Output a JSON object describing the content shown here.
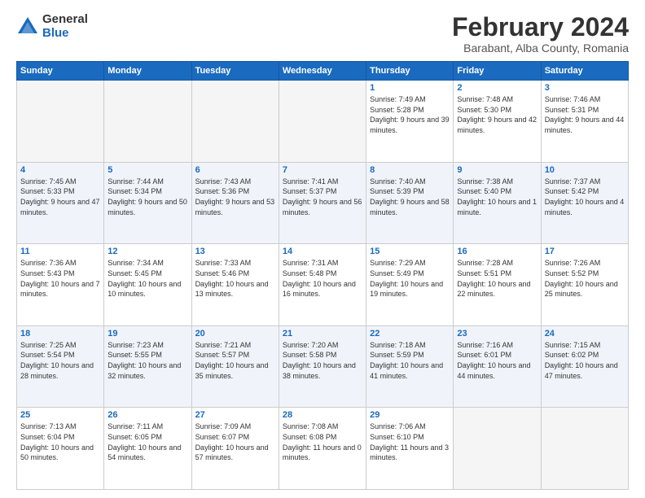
{
  "logo": {
    "general": "General",
    "blue": "Blue"
  },
  "title": "February 2024",
  "subtitle": "Barabant, Alba County, Romania",
  "weekdays": [
    "Sunday",
    "Monday",
    "Tuesday",
    "Wednesday",
    "Thursday",
    "Friday",
    "Saturday"
  ],
  "weeks": [
    [
      {
        "day": "",
        "info": ""
      },
      {
        "day": "",
        "info": ""
      },
      {
        "day": "",
        "info": ""
      },
      {
        "day": "",
        "info": ""
      },
      {
        "day": "1",
        "info": "Sunrise: 7:49 AM\nSunset: 5:28 PM\nDaylight: 9 hours\nand 39 minutes."
      },
      {
        "day": "2",
        "info": "Sunrise: 7:48 AM\nSunset: 5:30 PM\nDaylight: 9 hours\nand 42 minutes."
      },
      {
        "day": "3",
        "info": "Sunrise: 7:46 AM\nSunset: 5:31 PM\nDaylight: 9 hours\nand 44 minutes."
      }
    ],
    [
      {
        "day": "4",
        "info": "Sunrise: 7:45 AM\nSunset: 5:33 PM\nDaylight: 9 hours\nand 47 minutes."
      },
      {
        "day": "5",
        "info": "Sunrise: 7:44 AM\nSunset: 5:34 PM\nDaylight: 9 hours\nand 50 minutes."
      },
      {
        "day": "6",
        "info": "Sunrise: 7:43 AM\nSunset: 5:36 PM\nDaylight: 9 hours\nand 53 minutes."
      },
      {
        "day": "7",
        "info": "Sunrise: 7:41 AM\nSunset: 5:37 PM\nDaylight: 9 hours\nand 56 minutes."
      },
      {
        "day": "8",
        "info": "Sunrise: 7:40 AM\nSunset: 5:39 PM\nDaylight: 9 hours\nand 58 minutes."
      },
      {
        "day": "9",
        "info": "Sunrise: 7:38 AM\nSunset: 5:40 PM\nDaylight: 10 hours\nand 1 minute."
      },
      {
        "day": "10",
        "info": "Sunrise: 7:37 AM\nSunset: 5:42 PM\nDaylight: 10 hours\nand 4 minutes."
      }
    ],
    [
      {
        "day": "11",
        "info": "Sunrise: 7:36 AM\nSunset: 5:43 PM\nDaylight: 10 hours\nand 7 minutes."
      },
      {
        "day": "12",
        "info": "Sunrise: 7:34 AM\nSunset: 5:45 PM\nDaylight: 10 hours\nand 10 minutes."
      },
      {
        "day": "13",
        "info": "Sunrise: 7:33 AM\nSunset: 5:46 PM\nDaylight: 10 hours\nand 13 minutes."
      },
      {
        "day": "14",
        "info": "Sunrise: 7:31 AM\nSunset: 5:48 PM\nDaylight: 10 hours\nand 16 minutes."
      },
      {
        "day": "15",
        "info": "Sunrise: 7:29 AM\nSunset: 5:49 PM\nDaylight: 10 hours\nand 19 minutes."
      },
      {
        "day": "16",
        "info": "Sunrise: 7:28 AM\nSunset: 5:51 PM\nDaylight: 10 hours\nand 22 minutes."
      },
      {
        "day": "17",
        "info": "Sunrise: 7:26 AM\nSunset: 5:52 PM\nDaylight: 10 hours\nand 25 minutes."
      }
    ],
    [
      {
        "day": "18",
        "info": "Sunrise: 7:25 AM\nSunset: 5:54 PM\nDaylight: 10 hours\nand 28 minutes."
      },
      {
        "day": "19",
        "info": "Sunrise: 7:23 AM\nSunset: 5:55 PM\nDaylight: 10 hours\nand 32 minutes."
      },
      {
        "day": "20",
        "info": "Sunrise: 7:21 AM\nSunset: 5:57 PM\nDaylight: 10 hours\nand 35 minutes."
      },
      {
        "day": "21",
        "info": "Sunrise: 7:20 AM\nSunset: 5:58 PM\nDaylight: 10 hours\nand 38 minutes."
      },
      {
        "day": "22",
        "info": "Sunrise: 7:18 AM\nSunset: 5:59 PM\nDaylight: 10 hours\nand 41 minutes."
      },
      {
        "day": "23",
        "info": "Sunrise: 7:16 AM\nSunset: 6:01 PM\nDaylight: 10 hours\nand 44 minutes."
      },
      {
        "day": "24",
        "info": "Sunrise: 7:15 AM\nSunset: 6:02 PM\nDaylight: 10 hours\nand 47 minutes."
      }
    ],
    [
      {
        "day": "25",
        "info": "Sunrise: 7:13 AM\nSunset: 6:04 PM\nDaylight: 10 hours\nand 50 minutes."
      },
      {
        "day": "26",
        "info": "Sunrise: 7:11 AM\nSunset: 6:05 PM\nDaylight: 10 hours\nand 54 minutes."
      },
      {
        "day": "27",
        "info": "Sunrise: 7:09 AM\nSunset: 6:07 PM\nDaylight: 10 hours\nand 57 minutes."
      },
      {
        "day": "28",
        "info": "Sunrise: 7:08 AM\nSunset: 6:08 PM\nDaylight: 11 hours\nand 0 minutes."
      },
      {
        "day": "29",
        "info": "Sunrise: 7:06 AM\nSunset: 6:10 PM\nDaylight: 11 hours\nand 3 minutes."
      },
      {
        "day": "",
        "info": ""
      },
      {
        "day": "",
        "info": ""
      }
    ]
  ]
}
